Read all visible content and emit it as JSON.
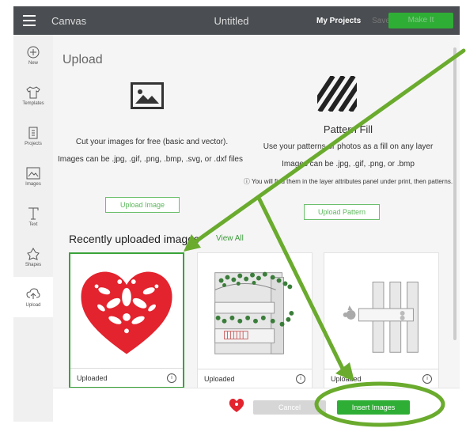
{
  "topbar": {
    "app_title": "Canvas",
    "doc_title": "Untitled",
    "my_projects": "My Projects",
    "save": "Save",
    "make": "Make It"
  },
  "sidebar": {
    "items": [
      {
        "label": "New",
        "icon": "plus-icon"
      },
      {
        "label": "Templates",
        "icon": "shirt-icon"
      },
      {
        "label": "Projects",
        "icon": "projects-icon"
      },
      {
        "label": "Images",
        "icon": "image-icon"
      },
      {
        "label": "Text",
        "icon": "text-icon"
      },
      {
        "label": "Shapes",
        "icon": "shapes-icon"
      },
      {
        "label": "Upload",
        "icon": "upload-icon"
      }
    ]
  },
  "upload": {
    "title": "Upload",
    "image_line1": "Cut your images for free (basic and vector).",
    "image_line2": "Images can be .jpg, .gif, .png, .bmp, .svg, or .dxf files",
    "upload_image_btn": "Upload Image",
    "pattern_title": "Pattern Fill",
    "pattern_line1": "Use your patterns or photos as a fill on any layer",
    "pattern_line2": "Images can be .jpg, .gif, .png, or .bmp",
    "pattern_note": "ⓘ You will find them in the layer attributes panel under print, then patterns.",
    "upload_pattern_btn": "Upload Pattern"
  },
  "recent": {
    "title": "Recently uploaded images",
    "view_all": "View All",
    "cards": [
      {
        "label": "Uploaded"
      },
      {
        "label": "Uploaded"
      },
      {
        "label": "Uploaded"
      }
    ]
  },
  "bottom": {
    "cancel": "Cancel",
    "insert": "Insert Images"
  },
  "colors": {
    "accent": "#2fae36",
    "annotation": "#6aab2e",
    "heart": "#e3232d"
  }
}
